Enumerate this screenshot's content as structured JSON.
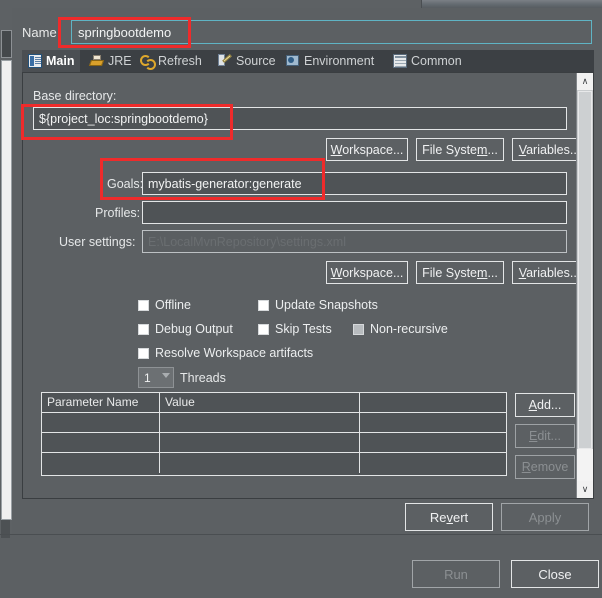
{
  "window": {
    "name_label": "Name",
    "name_value": "springbootdemo"
  },
  "tabs": [
    {
      "label": "Main",
      "icon": "main-icon",
      "active": true
    },
    {
      "label": "JRE",
      "icon": "jre-icon",
      "active": false
    },
    {
      "label": "Refresh",
      "icon": "refresh-icon",
      "active": false
    },
    {
      "label": "Source",
      "icon": "source-icon",
      "active": false
    },
    {
      "label": "Environment",
      "icon": "environment-icon",
      "active": false
    },
    {
      "label": "Common",
      "icon": "common-icon",
      "active": false
    }
  ],
  "main": {
    "base_directory_label": "Base directory:",
    "base_directory_value": "${project_loc:springbootdemo}",
    "browse_row1": [
      {
        "label": "Workspace...",
        "mnemonic": "W"
      },
      {
        "label": "File System...",
        "mnemonic": "m"
      },
      {
        "label": "Variables...",
        "mnemonic": "V"
      }
    ],
    "goals_label": "Goals:",
    "goals_value": "mybatis-generator:generate",
    "profiles_label": "Profiles:",
    "profiles_value": "",
    "user_settings_label": "User settings:",
    "user_settings_value": "E:\\LocalMvnRepository\\settings.xml",
    "user_settings_disabled": true,
    "browse_row2": [
      {
        "label": "Workspace...",
        "mnemonic": "W"
      },
      {
        "label": "File System...",
        "mnemonic": "m"
      },
      {
        "label": "Variables...",
        "mnemonic": "V"
      }
    ],
    "checkboxes": [
      {
        "label": "Offline",
        "checked": false,
        "dim": false
      },
      {
        "label": "Update Snapshots",
        "checked": false,
        "dim": false
      },
      {
        "label": "Debug Output",
        "checked": false,
        "dim": false
      },
      {
        "label": "Skip Tests",
        "checked": false,
        "dim": false
      },
      {
        "label": "Non-recursive",
        "checked": false,
        "dim": true
      },
      {
        "label": "Resolve Workspace artifacts",
        "checked": false,
        "dim": false
      }
    ],
    "threads_value": "1",
    "threads_label": "Threads",
    "table": {
      "headers": [
        "Parameter Name",
        "Value",
        ""
      ],
      "rows": [
        [
          "",
          "",
          ""
        ],
        [
          "",
          "",
          ""
        ],
        [
          "",
          "",
          ""
        ]
      ]
    },
    "table_buttons": [
      {
        "label": "Add...",
        "mnemonic": "A",
        "enabled": true
      },
      {
        "label": "Edit...",
        "mnemonic": "E",
        "enabled": false
      },
      {
        "label": "Remove",
        "mnemonic": "R",
        "enabled": false
      }
    ]
  },
  "footer": {
    "revert_label": "Revert",
    "apply_label": "Apply",
    "apply_enabled": false,
    "run_label": "Run",
    "run_enabled": false,
    "close_label": "Close"
  },
  "scrollbar": {
    "up_glyph": "∧",
    "down_glyph": "∨"
  },
  "annotations": {
    "accent_color": "#ef2b2b",
    "focus_color": "#5fb4c4",
    "boxes": [
      {
        "name": "name-field-highlight"
      },
      {
        "name": "base-directory-highlight"
      },
      {
        "name": "goals-highlight"
      }
    ]
  }
}
